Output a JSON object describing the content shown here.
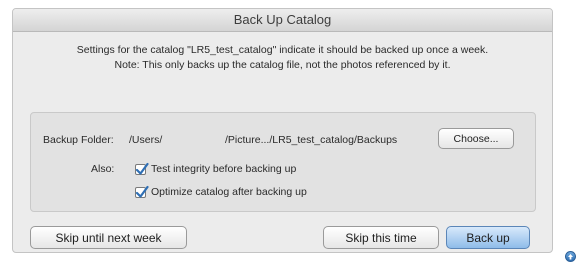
{
  "dialog": {
    "title": "Back Up Catalog",
    "message_line1": "Settings for the catalog \"LR5_test_catalog\" indicate it should be backed up once a week.",
    "message_line2": "Note: This only backs up the catalog file, not the photos referenced by it.",
    "backup_folder_label": "Backup Folder:",
    "backup_folder_path_start": "/Users/",
    "backup_folder_path_end": "/Picture.../LR5_test_catalog/Backups",
    "choose_button": "Choose...",
    "also_label": "Also:",
    "checkboxes": [
      {
        "label": "Test integrity before backing up",
        "checked": true
      },
      {
        "label": "Optimize catalog after backing up",
        "checked": true
      }
    ],
    "buttons": {
      "skip_week": "Skip until next week",
      "skip_time": "Skip this time",
      "back_up": "Back up"
    }
  },
  "icons": {
    "checkmark": "checkmark-icon",
    "corner": "arrow-up-circle-icon"
  },
  "colors": {
    "default_button": "#8fbce9",
    "checkmark": "#2f6fb4"
  }
}
